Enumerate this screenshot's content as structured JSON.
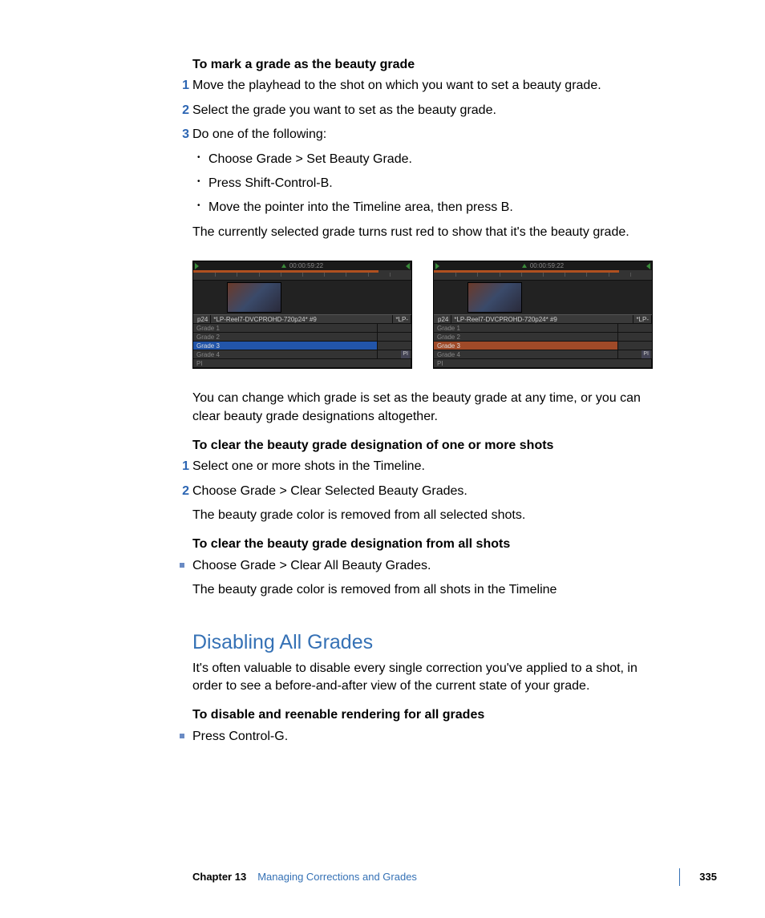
{
  "sec1": {
    "heading": "To mark a grade as the beauty grade",
    "steps": [
      "Move the playhead to the shot on which you want to set a beauty grade.",
      "Select the grade you want to set as the beauty grade.",
      "Do one of the following:"
    ],
    "sub": [
      "Choose Grade > Set Beauty Grade.",
      "Press Shift-Control-B.",
      "Move the pointer into the Timeline area, then press B."
    ],
    "result": "The currently selected grade turns rust red to show that it's the beauty grade."
  },
  "figs": {
    "timecode": "00:00:59:22",
    "clip_prefix": "p24",
    "clip_name": "*LP-Reel7-DVCPROHD-720p24* #9",
    "clip_suffix": "*LP-",
    "grades": [
      "Grade 1",
      "Grade 2",
      "Grade 3",
      "Grade 4"
    ],
    "pi": "PI"
  },
  "mid_para": "You can change which grade is set as the beauty grade at any time, or you can clear beauty grade designations altogether.",
  "sec2": {
    "heading": "To clear the beauty grade designation of one or more shots",
    "steps": [
      "Select one or more shots in the Timeline.",
      "Choose Grade > Clear Selected Beauty Grades."
    ],
    "result": "The beauty grade color is removed from all selected shots."
  },
  "sec3": {
    "heading": "To clear the beauty grade designation from all shots",
    "bullet": "Choose Grade > Clear All Beauty Grades.",
    "result": "The beauty grade color is removed from all shots in the Timeline"
  },
  "sec4": {
    "title": "Disabling All Grades",
    "intro": "It's often valuable to disable every single correction you've applied to a shot, in order to see a before-and-after view of the current state of your grade.",
    "heading": "To disable and reenable rendering for all grades",
    "bullet": "Press Control-G."
  },
  "footer": {
    "chapter": "Chapter 13",
    "title": "Managing Corrections and Grades",
    "page": "335"
  }
}
